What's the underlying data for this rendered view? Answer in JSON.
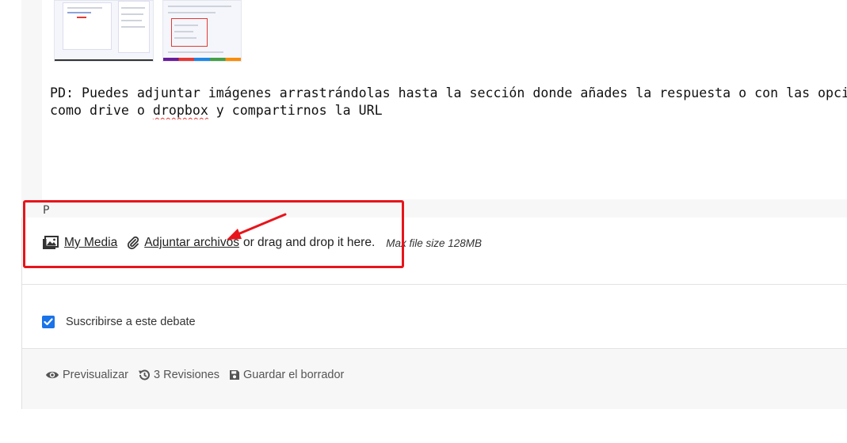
{
  "reply": {
    "line1": "PD: Puedes adjuntar imágenes arrastrándolas hasta la sección donde añades la respuesta o con las opciones del e",
    "line2_before": "como drive o ",
    "line2_misspelled": "dropbox",
    "line2_after": " y compartirnos la URL"
  },
  "editor": {
    "path": "P"
  },
  "attachments": {
    "my_media_label": "My Media",
    "attach_label": "Adjuntar archivos",
    "drag_text": "or drag and drop it here.",
    "max_size": "Max file size 128MB"
  },
  "subscribe": {
    "label": "Suscribirse a este debate",
    "checked": true
  },
  "footer": {
    "preview_label": "Previsualizar",
    "revisions_label": "3 Revisiones",
    "save_draft_label": "Guardar el borrador"
  },
  "colors": {
    "highlight": "#e8141b",
    "checkbox": "#1a73e8"
  },
  "icons": [
    "media-icon",
    "paperclip-icon",
    "eye-icon",
    "history-icon",
    "floppy-disk-icon",
    "checkmark-icon",
    "arrow-icon"
  ]
}
